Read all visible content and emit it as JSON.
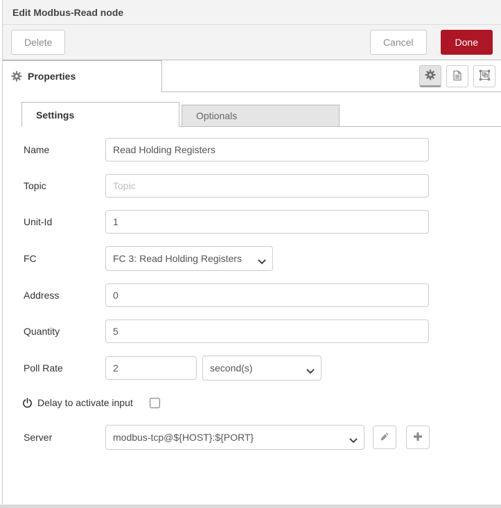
{
  "header": {
    "title": "Edit Modbus-Read node"
  },
  "actions": {
    "delete": "Delete",
    "cancel": "Cancel",
    "done": "Done"
  },
  "editor_tabs": {
    "properties": "Properties"
  },
  "inner_tabs": {
    "settings": "Settings",
    "optionals": "Optionals"
  },
  "form": {
    "name": {
      "label": "Name",
      "value": "Read Holding Registers"
    },
    "topic": {
      "label": "Topic",
      "value": "",
      "placeholder": "Topic"
    },
    "unit_id": {
      "label": "Unit-Id",
      "value": "1"
    },
    "fc": {
      "label": "FC",
      "value": "FC 3: Read Holding Registers"
    },
    "address": {
      "label": "Address",
      "value": "0"
    },
    "quantity": {
      "label": "Quantity",
      "value": "5"
    },
    "poll_rate": {
      "label": "Poll Rate",
      "value": "2",
      "unit_value": "second(s)"
    },
    "delay": {
      "label": "Delay to activate input",
      "checked": false
    },
    "server": {
      "label": "Server",
      "value": "modbus-tcp@${HOST}:${PORT}"
    }
  },
  "icons": {
    "properties_tab": "gear-icon",
    "node_settings": "gear-icon",
    "description": "file-text-icon",
    "appearance": "object-group-icon",
    "delay": "power-icon",
    "edit": "pencil-icon",
    "add": "plus-icon",
    "select_caret": "chevron-down-icon"
  },
  "colors": {
    "done_button": "#ad1625",
    "header_bg": "#f3f3f3",
    "border": "#bbbbbb",
    "inactive_tab_bg": "#e5e5e5"
  }
}
